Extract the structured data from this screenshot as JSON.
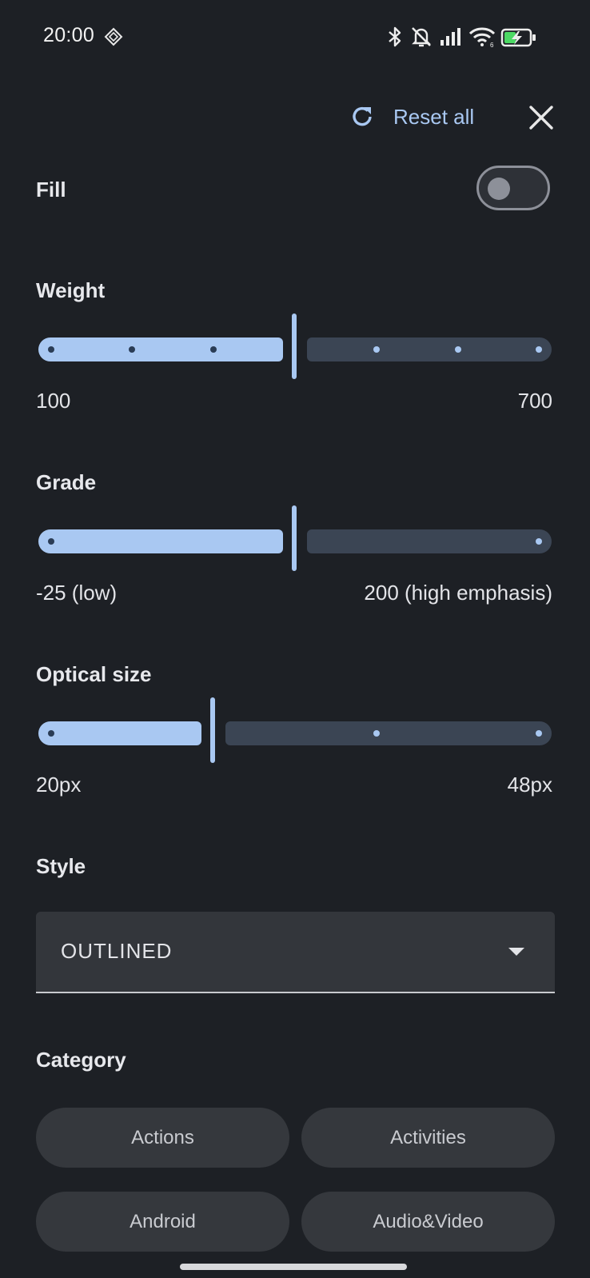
{
  "status_bar": {
    "time": "20:00",
    "icons": [
      "sync-icon",
      "bluetooth-icon",
      "bell-muted-icon",
      "signal-icon",
      "wifi-icon",
      "battery-charging-icon"
    ]
  },
  "header": {
    "reset_label": "Reset all",
    "reset_icon": "refresh-icon",
    "close_icon": "close-icon"
  },
  "fill": {
    "label": "Fill",
    "enabled": false
  },
  "weight": {
    "label": "Weight",
    "min_label": "100",
    "max_label": "700",
    "min": 100,
    "max": 700,
    "step": 100,
    "value": 400
  },
  "grade": {
    "label": "Grade",
    "min_label": "-25 (low)",
    "max_label": "200 (high emphasis)",
    "options": [
      -25,
      0,
      200
    ],
    "value": 0
  },
  "optical_size": {
    "label": "Optical size",
    "min_label": "20px",
    "max_label": "48px",
    "options": [
      20,
      24,
      40,
      48
    ],
    "value": 24
  },
  "style": {
    "label": "Style",
    "selected": "OUTLINED"
  },
  "category": {
    "label": "Category",
    "chips": [
      "Actions",
      "Activities",
      "Android",
      "Audio&Video"
    ]
  },
  "colors": {
    "background": "#1d2025",
    "accent": "#a9c8f2",
    "inactive_track": "#3b4554",
    "chip_bg": "#35383d"
  }
}
